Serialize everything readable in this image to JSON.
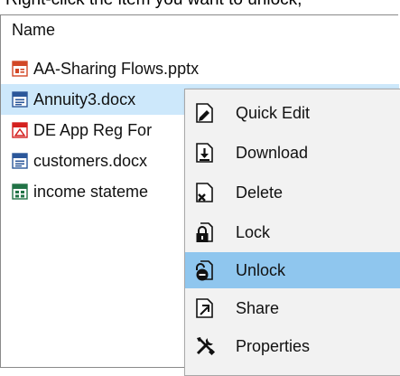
{
  "instruction": "Right-click the item you want to unlock,",
  "list": {
    "column_header": "Name",
    "files": [
      {
        "name": "AA-Sharing Flows.pptx",
        "icon": "pptx-file-icon",
        "color": "#d24726"
      },
      {
        "name": "Annuity3.docx",
        "icon": "docx-file-icon",
        "color": "#2b579a"
      },
      {
        "name": "DE App  Reg For",
        "icon": "pdf-file-icon",
        "color": "#d4201e"
      },
      {
        "name": "customers.docx",
        "icon": "docx-file-icon",
        "color": "#2b579a"
      },
      {
        "name": "income stateme",
        "icon": "xlsx-file-icon",
        "color": "#217346"
      }
    ]
  },
  "context_menu": {
    "items": [
      {
        "label": "Quick Edit",
        "icon": "quick-edit-icon"
      },
      {
        "label": "Download",
        "icon": "download-icon"
      },
      {
        "label": "Delete",
        "icon": "delete-icon"
      },
      {
        "label": "Lock",
        "icon": "lock-icon"
      },
      {
        "label": "Unlock",
        "icon": "unlock-icon"
      },
      {
        "label": "Share",
        "icon": "share-icon"
      },
      {
        "label": "Properties",
        "icon": "properties-icon"
      }
    ]
  },
  "colors": {
    "selection": "#cde8fb",
    "menu_hover": "#8fc6ee",
    "menu_background": "#f2f2f2"
  }
}
